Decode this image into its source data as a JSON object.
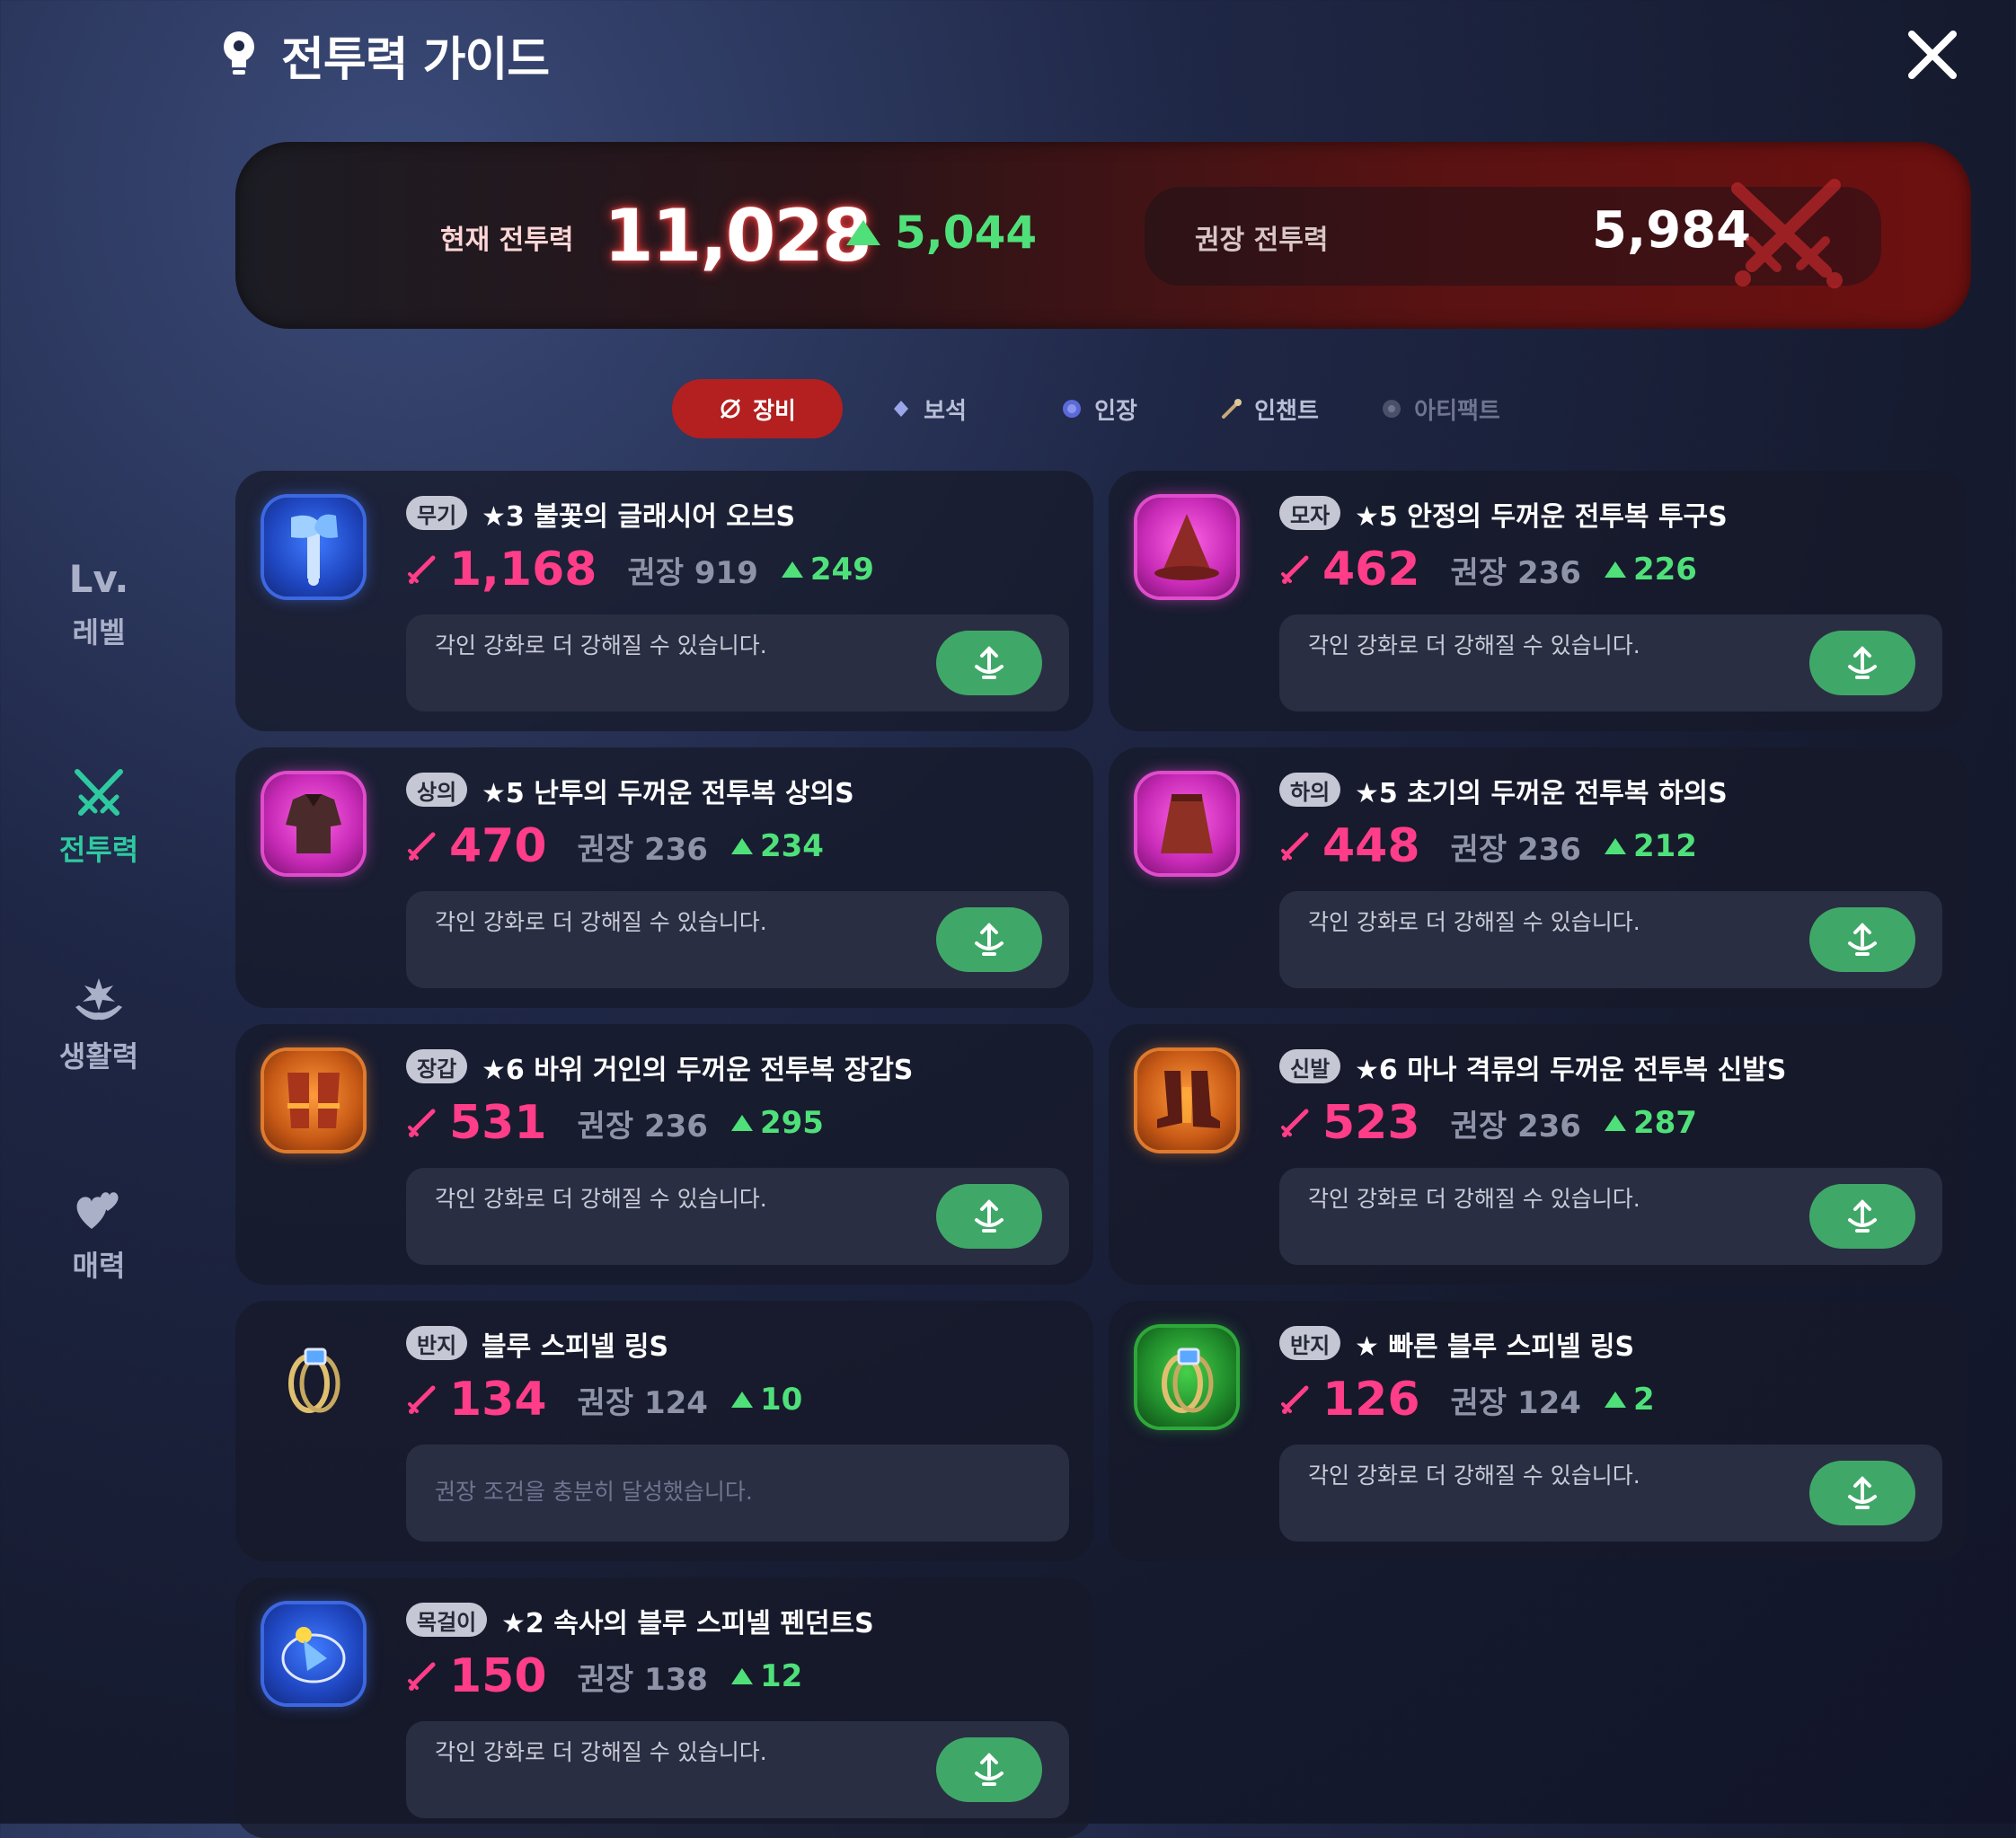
{
  "header": {
    "title": "전투력 가이드"
  },
  "summary": {
    "current_label": "현재 전투력",
    "current_value": "11,028",
    "current_diff": "5,044",
    "recommended_label": "권장 전투력",
    "recommended_value": "5,984"
  },
  "tabs": [
    {
      "label": "장비",
      "icon": "equipment-icon",
      "active": true
    },
    {
      "label": "보석",
      "icon": "gem-icon"
    },
    {
      "label": "인장",
      "icon": "seal-icon"
    },
    {
      "label": "인챈트",
      "icon": "enchant-icon"
    },
    {
      "label": "아티팩트",
      "icon": "artifact-icon",
      "disabled": true
    }
  ],
  "sidenav": [
    {
      "top": "Lv.",
      "label": "레벨"
    },
    {
      "label": "전투력",
      "active": true,
      "icon": "crossed-swords-icon"
    },
    {
      "label": "생활력",
      "icon": "sprout-hands-icon"
    },
    {
      "label": "매력",
      "icon": "hearts-icon"
    }
  ],
  "rec_prefix": "권장",
  "items": [
    {
      "slot": "무기",
      "name": "★3 불꽃의 글래시어 오브S",
      "power": "1,168",
      "rec": "919",
      "diff": "249",
      "frame": "blue",
      "msg": "각인 강화로 더 강해질 수 있습니다.",
      "icon": "axe-icon"
    },
    {
      "slot": "모자",
      "name": "★5 안정의 두꺼운 전투복 투구S",
      "power": "462",
      "rec": "236",
      "diff": "226",
      "frame": "pink",
      "msg": "각인 강화로 더 강해질 수 있습니다.",
      "icon": "hat-icon"
    },
    {
      "slot": "상의",
      "name": "★5 난투의 두꺼운 전투복 상의S",
      "power": "470",
      "rec": "236",
      "diff": "234",
      "frame": "pink",
      "msg": "각인 강화로 더 강해질 수 있습니다.",
      "icon": "armor-top-icon"
    },
    {
      "slot": "하의",
      "name": "★5 초기의 두꺼운 전투복 하의S",
      "power": "448",
      "rec": "236",
      "diff": "212",
      "frame": "pink",
      "msg": "각인 강화로 더 강해질 수 있습니다.",
      "icon": "skirt-icon"
    },
    {
      "slot": "장갑",
      "name": "★6 바위 거인의 두꺼운 전투복 장갑S",
      "power": "531",
      "rec": "236",
      "diff": "295",
      "frame": "orange",
      "msg": "각인 강화로 더 강해질 수 있습니다.",
      "icon": "gloves-icon"
    },
    {
      "slot": "신발",
      "name": "★6 마나 격류의 두꺼운 전투복 신발S",
      "power": "523",
      "rec": "236",
      "diff": "287",
      "frame": "orange",
      "msg": "각인 강화로 더 강해질 수 있습니다.",
      "icon": "boots-icon"
    },
    {
      "slot": "반지",
      "name": "블루 스피넬 링S",
      "power": "134",
      "rec": "124",
      "diff": "10",
      "frame": "none",
      "msg": "권장 조건을 충분히 달성했습니다.",
      "icon": "ring-icon",
      "done": true
    },
    {
      "slot": "반지",
      "name": "★ 빠른 블루 스피넬 링S",
      "power": "126",
      "rec": "124",
      "diff": "2",
      "frame": "green",
      "msg": "각인 강화로 더 강해질 수 있습니다.",
      "icon": "ring-icon"
    },
    {
      "slot": "목걸이",
      "name": "★2 속사의 블루 스피넬 펜던트S",
      "power": "150",
      "rec": "138",
      "diff": "12",
      "frame": "blue",
      "msg": "각인 강화로 더 강해질 수 있습니다.",
      "icon": "pendant-icon"
    }
  ],
  "colors": {
    "power": "#ff3d88",
    "up": "#4fe07a",
    "button": "#3fa868",
    "active_tab": "#b41f1f",
    "active_nav": "#2fc9a0"
  }
}
